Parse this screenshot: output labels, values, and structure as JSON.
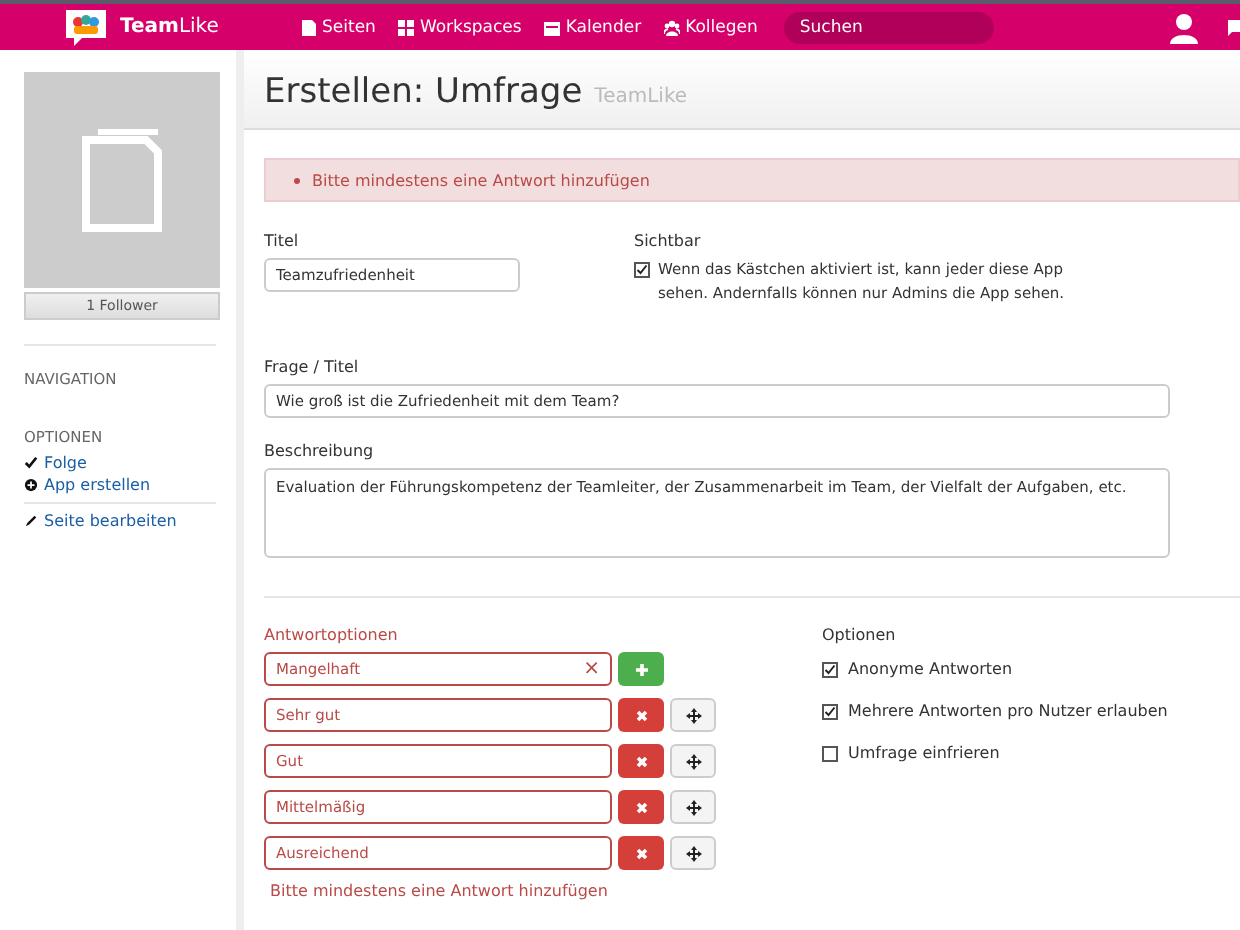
{
  "topbar": {
    "brand_bold": "Team",
    "brand_light": "Like",
    "nav": [
      {
        "label": "Seiten",
        "kind": "page"
      },
      {
        "label": "Workspaces",
        "kind": "grid"
      },
      {
        "label": "Kalender",
        "kind": "calendar"
      },
      {
        "label": "Kollegen",
        "kind": "people"
      }
    ],
    "search": {
      "placeholder": "Suchen"
    }
  },
  "sidebar": {
    "follower_button": "1 Follower",
    "navigation_heading": "NAVIGATION",
    "options_heading": "OPTIONEN",
    "options": [
      {
        "label": "Folge",
        "kind": "check"
      },
      {
        "label": "App erstellen",
        "kind": "plus"
      }
    ],
    "edit_link": "Seite bearbeiten"
  },
  "header": {
    "title": "Erstellen: Umfrage",
    "subtitle": "TeamLike"
  },
  "alert": "Bitte mindestens eine Antwort hinzufügen",
  "title_field": {
    "label": "Titel",
    "value": "Teamzufriedenheit"
  },
  "visibility": {
    "label": "Sichtbar",
    "checked": true,
    "text": "Wenn das Kästchen aktiviert ist, kann jeder diese App sehen. Andernfalls können nur Admins die App sehen."
  },
  "question_field": {
    "label": "Frage / Titel",
    "value": "Wie groß ist die Zufriedenheit mit dem Team?"
  },
  "description_field": {
    "label": "Beschreibung",
    "value": "Evaluation der Führungskompetenz der Teamleiter, der Zusammenarbeit im Team, der Vielfalt der Aufgaben, etc."
  },
  "answers": {
    "label": "Antwortoptionen",
    "items": [
      {
        "kind": "new",
        "value": "Mangelhaft",
        "clear": "×"
      },
      {
        "kind": "existing",
        "value": "Sehr gut"
      },
      {
        "kind": "existing",
        "value": "Gut"
      },
      {
        "kind": "existing",
        "value": "Mittelmäßig"
      },
      {
        "kind": "existing",
        "value": "Ausreichend"
      }
    ],
    "error": "Bitte mindestens eine Antwort hinzufügen"
  },
  "options": {
    "label": "Optionen",
    "items": [
      {
        "label": "Anonyme Antworten",
        "checked": true
      },
      {
        "label": "Mehrere Antworten pro Nutzer erlauben",
        "checked": true
      },
      {
        "label": "Umfrage einfrieren",
        "checked": false
      }
    ]
  }
}
